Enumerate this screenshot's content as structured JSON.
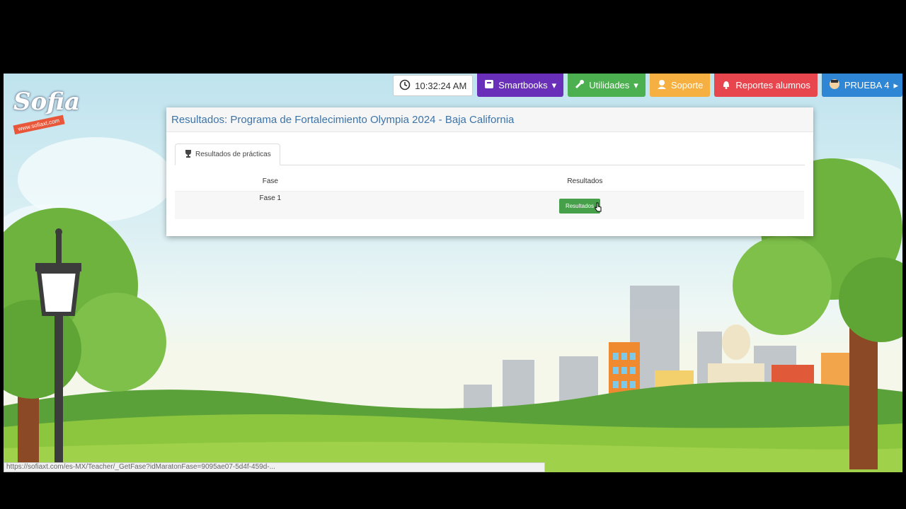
{
  "topbar": {
    "time": "10:32:24 AM",
    "smartbooks": "Smartbooks",
    "utilidades": "Utilidades",
    "soporte": "Soporte",
    "reportes": "Reportes alumnos",
    "user": "PRUEBA 4"
  },
  "logo": {
    "name": "Sofia",
    "url": "www.sofiaxt.com"
  },
  "panel": {
    "title": "Resultados: Programa de Fortalecimiento Olympia 2024 - Baja California",
    "tab": "Resultados de prácticas",
    "columns": [
      "Fase",
      "Resultados"
    ],
    "rows": [
      {
        "fase": "Fase 1",
        "button": "Resultados"
      }
    ]
  },
  "status_url": "https://sofiaxt.com/es-MX/Teacher/_GetFase?idMaratonFase=9095ae07-5d4f-459d-...",
  "colors": {
    "title": "#3d74a8",
    "result_button": "#45a049",
    "smartbooks": "#6a2fb8",
    "utilidades": "#4cb050",
    "soporte": "#f5b041",
    "reportes": "#e8464e",
    "prueba": "#2f86d4"
  },
  "icons": [
    "clock-icon",
    "book-icon",
    "wrench-icon",
    "support-person-icon",
    "bell-icon",
    "user-avatar-icon",
    "trophy-icon",
    "hand-cursor-icon"
  ]
}
